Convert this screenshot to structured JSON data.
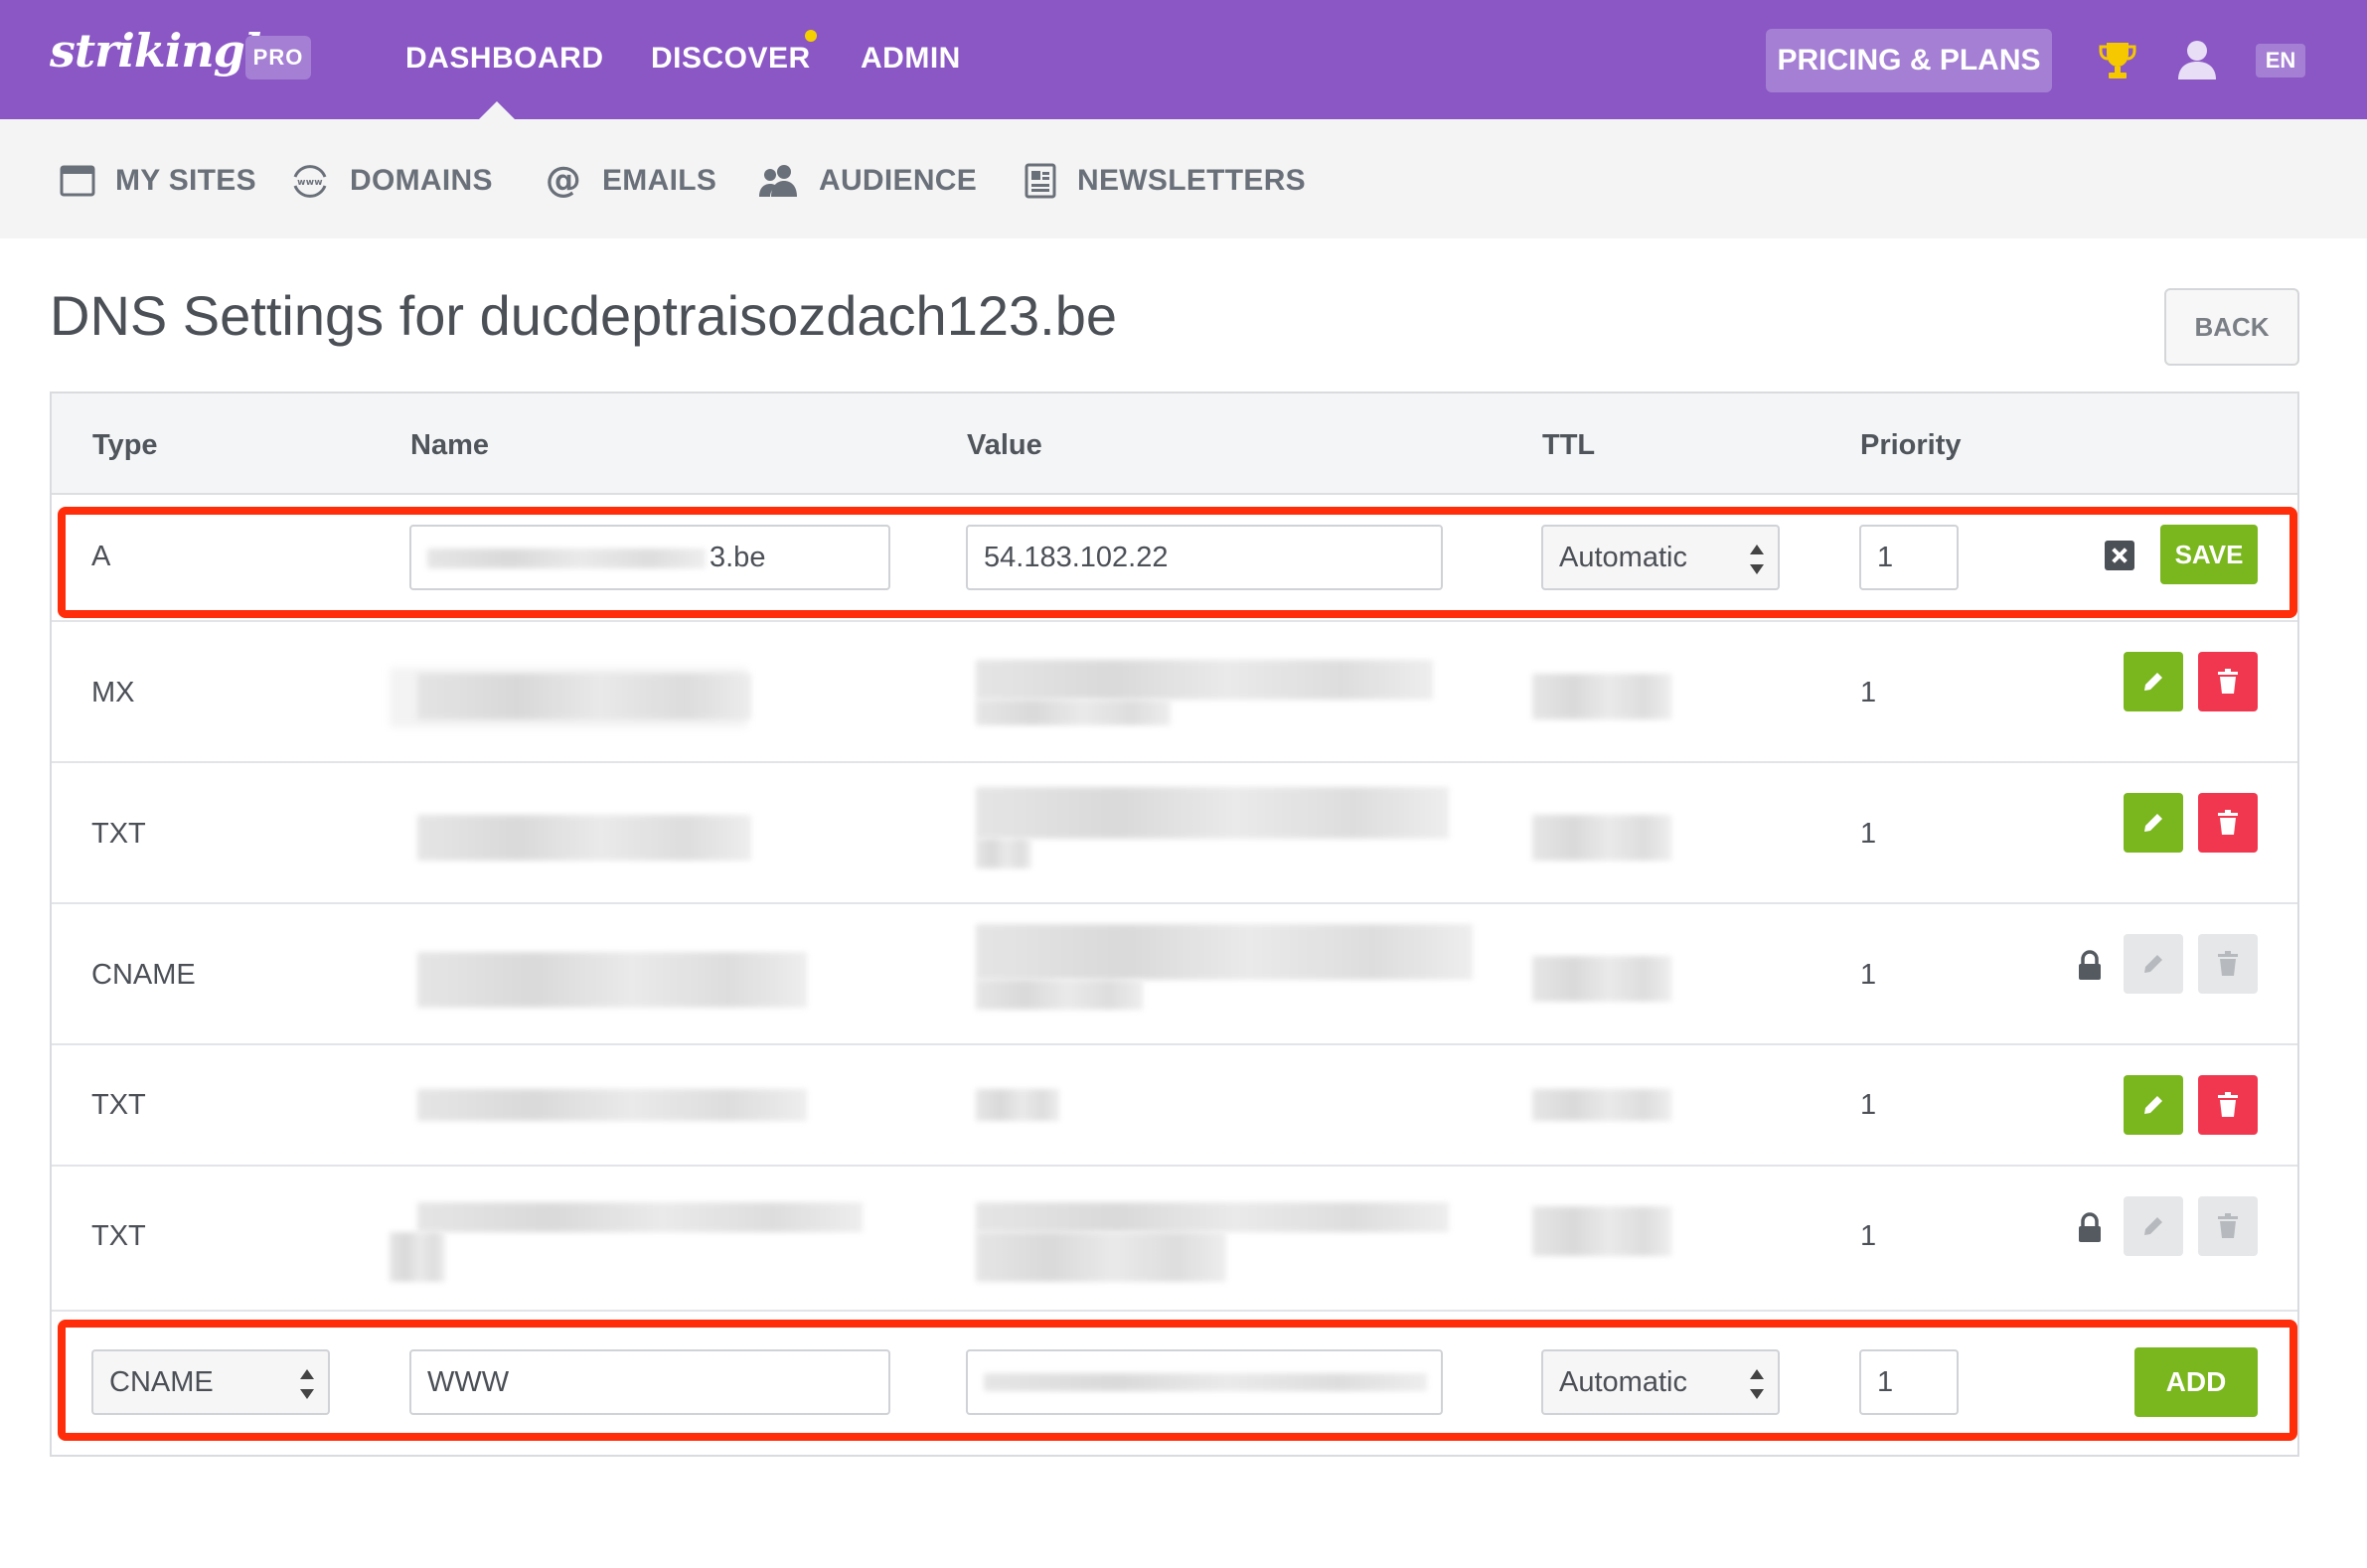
{
  "topbar": {
    "logo": "strikingly",
    "pro_badge": "PRO",
    "nav": [
      "DASHBOARD",
      "DISCOVER",
      "ADMIN"
    ],
    "pricing": "PRICING & PLANS",
    "lang": "EN"
  },
  "subnav": {
    "items": [
      "MY SITES",
      "DOMAINS",
      "EMAILS",
      "AUDIENCE",
      "NEWSLETTERS"
    ]
  },
  "page": {
    "title": "DNS Settings for ducdeptraisozdach123.be",
    "back": "BACK"
  },
  "table": {
    "headers": [
      "Type",
      "Name",
      "Value",
      "TTL",
      "Priority"
    ],
    "edit_row": {
      "type": "A",
      "name_suffix": "3.be",
      "value": "54.183.102.22",
      "ttl": "Automatic",
      "priority": "1",
      "save": "SAVE"
    },
    "rows": [
      {
        "type": "MX",
        "priority": "1"
      },
      {
        "type": "TXT",
        "priority": "1"
      },
      {
        "type": "CNAME",
        "priority": "1"
      },
      {
        "type": "TXT",
        "priority": "1"
      },
      {
        "type": "TXT",
        "priority": "1"
      }
    ],
    "add_row": {
      "type": "CNAME",
      "name": "WWW",
      "ttl": "Automatic",
      "priority": "1",
      "add": "ADD"
    }
  },
  "colors": {
    "brand_purple": "#8a57c5",
    "green": "#7ab61d",
    "red": "#f1374f",
    "highlight": "#ff2d0a"
  }
}
